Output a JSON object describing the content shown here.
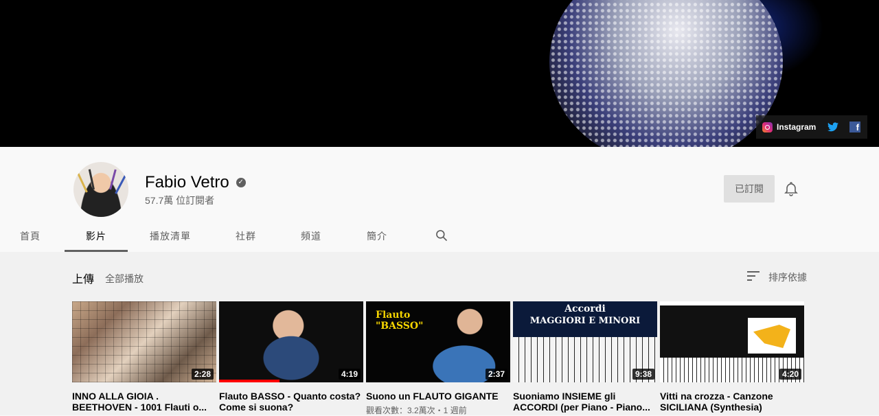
{
  "banner": {
    "social": {
      "instagram_label": "Instagram"
    }
  },
  "channel": {
    "name": "Fabio Vetro",
    "subscribers": "57.7萬 位訂閱者",
    "subscribed_label": "已訂閱"
  },
  "tabs": [
    {
      "label": "首頁",
      "active": false
    },
    {
      "label": "影片",
      "active": true
    },
    {
      "label": "播放清單",
      "active": false
    },
    {
      "label": "社群",
      "active": false
    },
    {
      "label": "頻道",
      "active": false
    },
    {
      "label": "簡介",
      "active": false
    }
  ],
  "section": {
    "title": "上傳",
    "play_all": "全部播放",
    "sort_label": "排序依據"
  },
  "videos": [
    {
      "title": "INNO ALLA GIOIA . BEETHOVEN - 1001 Flauti o...",
      "duration": "2:28",
      "meta": ""
    },
    {
      "title": "Flauto BASSO - Quanto costa? Come si suona?",
      "duration": "4:19",
      "meta": "",
      "watched_fraction": 0.42
    },
    {
      "title": "Suono un FLAUTO GIGANTE",
      "duration": "2:37",
      "meta": "觀看次數：3.2萬次・1 週前",
      "overlay": [
        "Flauto",
        "\"BASSO\""
      ]
    },
    {
      "title": "Suoniamo INSIEME gli ACCORDI (per Piano - Piano...",
      "duration": "9:38",
      "meta": "",
      "overlay": [
        "Accordi",
        "MAGGIORI E MINORI"
      ]
    },
    {
      "title": "Vitti na crozza - Canzone SICILIANA (Synthesia)",
      "duration": "4:20",
      "meta": ""
    }
  ],
  "colors": {
    "accent_red": "#ff0000",
    "text_primary": "#030303",
    "text_secondary": "#606060",
    "twitter": "#1da1f2",
    "facebook": "#3b5998"
  }
}
